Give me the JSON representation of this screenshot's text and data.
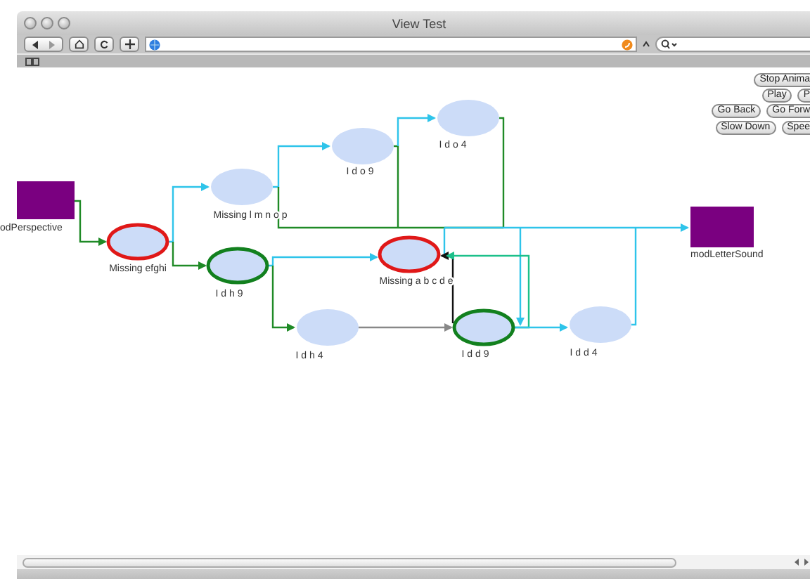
{
  "window": {
    "title": "View Test"
  },
  "controls": [
    {
      "label": "Stop Anima"
    },
    {
      "label": "Play"
    },
    {
      "label": "P"
    },
    {
      "label": "Go Back"
    },
    {
      "label": "Go Forw"
    },
    {
      "label": "Slow Down"
    },
    {
      "label": "Spee"
    }
  ],
  "nodes": [
    {
      "kind": "box",
      "label": "odPerspective"
    },
    {
      "kind": "oval",
      "label": "Missing efghi",
      "color": "#e01818"
    },
    {
      "kind": "oval",
      "label": "Missing l m n o p"
    },
    {
      "kind": "oval",
      "label": "I d h 9",
      "color": "#12801e"
    },
    {
      "kind": "oval",
      "label": "I d o 9"
    },
    {
      "kind": "oval",
      "label": "I d o 4"
    },
    {
      "kind": "oval",
      "label": "Missing a b c d e",
      "color": "#e01818"
    },
    {
      "kind": "oval",
      "label": "I d h 4"
    },
    {
      "kind": "oval",
      "label": "I d d 9",
      "color": "#12801e"
    },
    {
      "kind": "oval",
      "label": "I d d 4"
    },
    {
      "kind": "box",
      "label": "modLetterSound"
    }
  ]
}
